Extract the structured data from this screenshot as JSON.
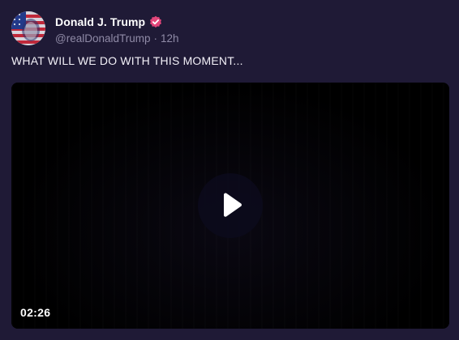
{
  "post": {
    "author": {
      "display_name": "Donald J. Trump",
      "handle": "@realDonaldTrump",
      "separator": "·",
      "timestamp": "12h",
      "verified_icon": "verified-badge-icon",
      "verified_color": "#e3457a"
    },
    "text": "WHAT WILL WE DO WITH THIS MOMENT...",
    "video": {
      "duration": "02:26",
      "play_icon": "play-icon"
    }
  },
  "colors": {
    "background": "#1f1a36",
    "secondary_text": "#8f8aa6",
    "video_background": "#000000"
  }
}
